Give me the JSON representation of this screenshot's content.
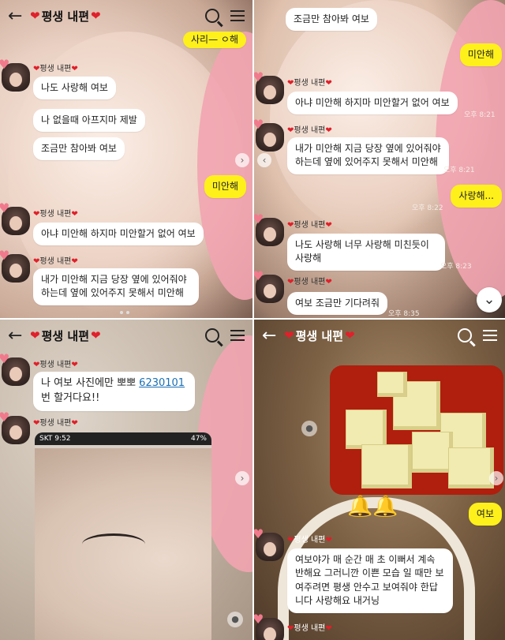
{
  "chat_title": "평생 내편",
  "sender_name": "평생 내편",
  "panel1": {
    "partial_top": "사리— ㅇ해",
    "msg1": "나도 사랑해 여보",
    "msg2": "나 없을때 아프지마 제발",
    "msg3": "조금만 참아봐 여보",
    "msg4_me": "미안해",
    "msg5": "아냐 미안해 하지마 미안할거 없어 여보",
    "msg6": "내가 미안해 지금 당장 옆에 있어줘야 하는데 옆에 있어주지 못해서 미안해"
  },
  "panel2": {
    "msg1": "조금만 참아봐 여보",
    "msg2_me": "미안해",
    "time2": "오후 8:21",
    "msg3": "아냐 미안해 하지마 미안할거 없어 여보",
    "time3": "오후 8:21",
    "msg4": "내가 미안해 지금 당장 옆에 있어줘야 하는데 옆에 있어주지 못해서 미안해",
    "time4": "오후 8:21",
    "msg5_me": "사랑해...",
    "time5": "오후 8:22",
    "msg6": "나도 사랑해 너무 사랑해 미친듯이 사랑해",
    "time6": "오후 8:23",
    "msg7": "여보 조금만 기다려줘",
    "time7": "오후 8:35"
  },
  "panel3": {
    "msg1_pre": "나 여보 사진에만 뽀뽀 ",
    "msg1_link": "6230101",
    "msg1_post": "번 할거다요!!",
    "phone_status_left": "SKT 9:52",
    "phone_status_right": "47%"
  },
  "panel4": {
    "msg_me": "여보",
    "msg2": "여보야가 매 순간 매 초 이뻐서 계속 반해요 그러니깐 이쁜 모습 일 때만 보여주려면 평생 안수고 보여줘야 한답니다 사랑해요 내거닝"
  }
}
